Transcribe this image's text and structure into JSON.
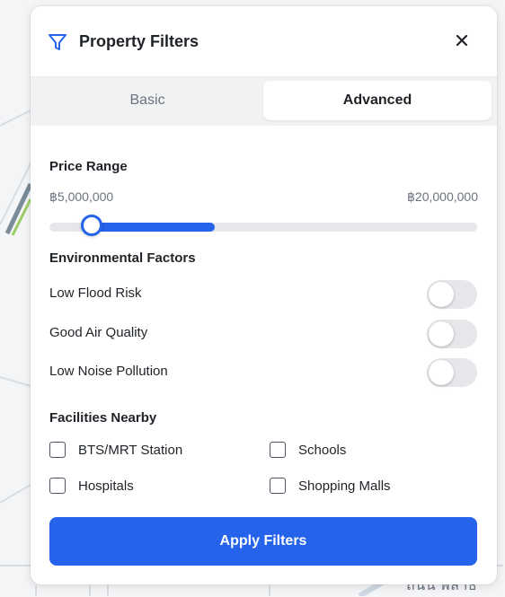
{
  "map": {
    "street_label": "ถนน พลาธิ"
  },
  "panel": {
    "title": "Property Filters",
    "filter_icon": "filter-funnel-icon",
    "close_icon": "close-icon",
    "close_glyph": "✕"
  },
  "tabs": [
    {
      "label": "Basic",
      "active": false
    },
    {
      "label": "Advanced",
      "active": true
    }
  ],
  "price_range": {
    "title": "Price Range",
    "min_label": "฿5,000,000",
    "max_label": "฿20,000,000"
  },
  "environmental": {
    "title": "Environmental Factors",
    "factors": [
      {
        "label": "Low Flood Risk",
        "enabled": false
      },
      {
        "label": "Good Air Quality",
        "enabled": false
      },
      {
        "label": "Low Noise Pollution",
        "enabled": false
      }
    ]
  },
  "facilities": {
    "title": "Facilities Nearby",
    "items": [
      {
        "label": "BTS/MRT Station",
        "checked": false
      },
      {
        "label": "Schools",
        "checked": false
      },
      {
        "label": "Hospitals",
        "checked": false
      },
      {
        "label": "Shopping Malls",
        "checked": false
      }
    ]
  },
  "apply_button": {
    "label": "Apply Filters"
  },
  "colors": {
    "accent": "#2563eb",
    "toggle_off": "#e5e7eb",
    "text_primary": "#1f2328",
    "text_muted": "#6b7280"
  }
}
